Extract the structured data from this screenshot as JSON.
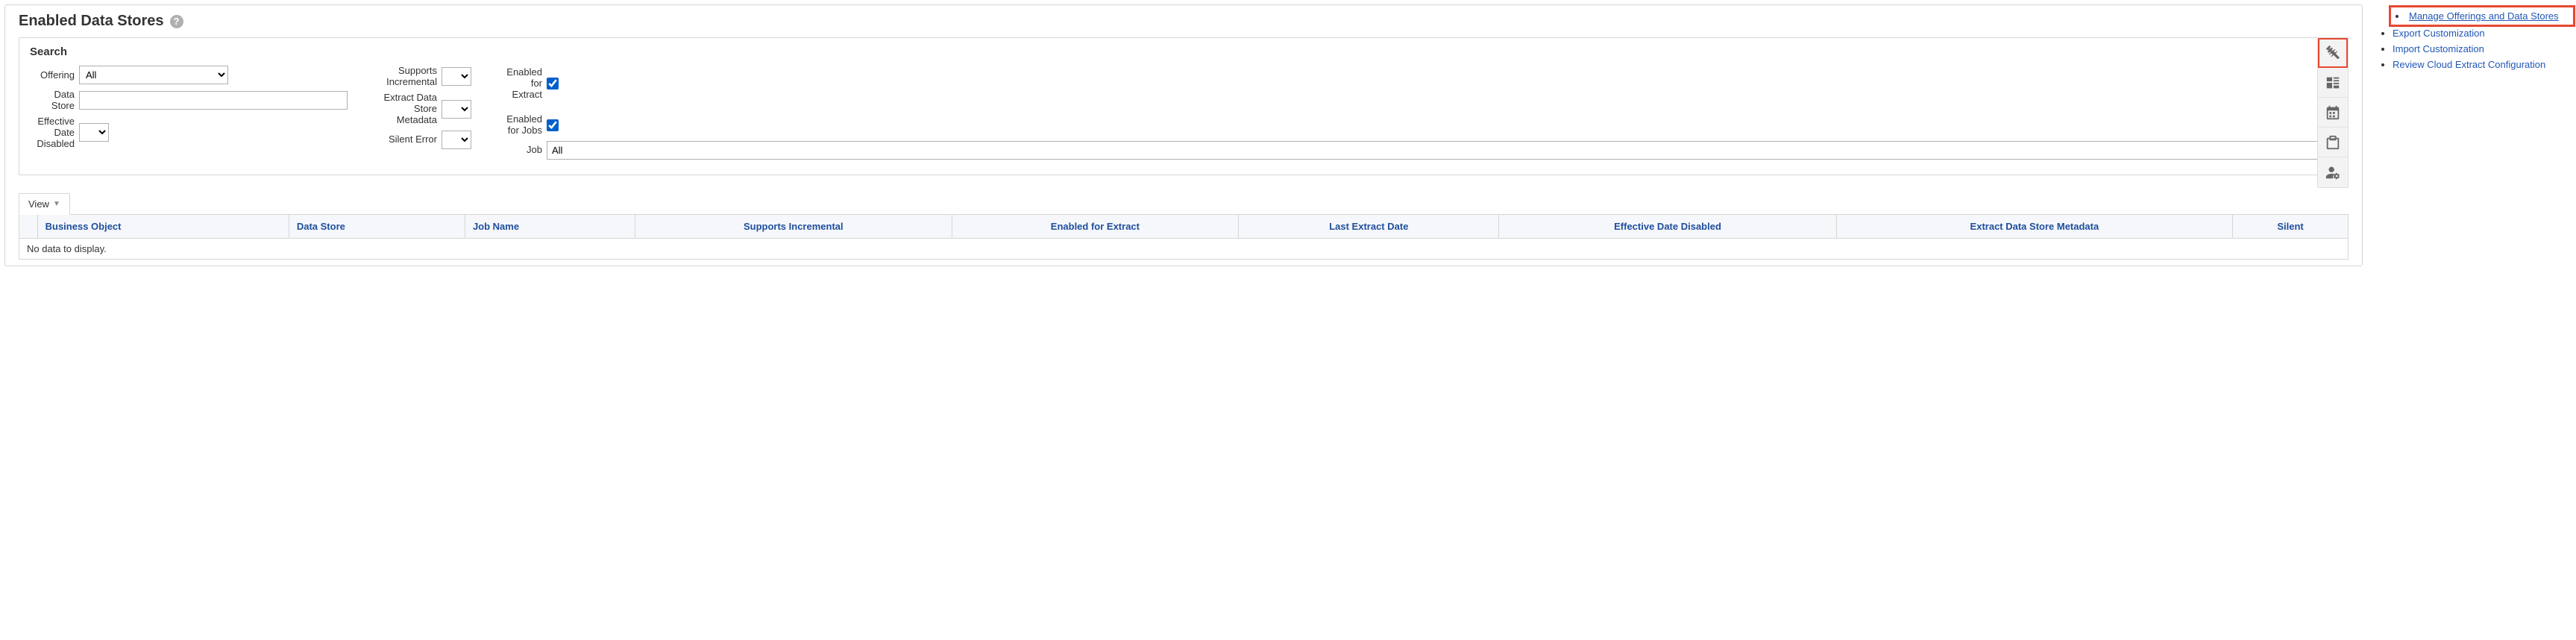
{
  "page": {
    "title": "Enabled Data Stores"
  },
  "search": {
    "title": "Search",
    "offering": {
      "label": "Offering",
      "value": "All"
    },
    "data_store": {
      "label": "Data Store",
      "value": ""
    },
    "effective_date_disabled": {
      "label": "Effective Date Disabled",
      "value": ""
    },
    "supports_incremental": {
      "label": "Supports Incremental",
      "value": ""
    },
    "extract_data_store_metadata": {
      "label": "Extract Data Store Metadata",
      "value": ""
    },
    "silent_error": {
      "label": "Silent Error",
      "value": ""
    },
    "enabled_for_extract": {
      "label": "Enabled for Extract",
      "checked": true
    },
    "enabled_for_jobs": {
      "label": "Enabled for Jobs",
      "checked": true
    },
    "job": {
      "label": "Job",
      "value": "All"
    }
  },
  "view": {
    "label": "View"
  },
  "table": {
    "columns": [
      "Business Object",
      "Data Store",
      "Job Name",
      "Supports Incremental",
      "Enabled for Extract",
      "Last Extract Date",
      "Effective Date Disabled",
      "Extract Data Store Metadata",
      "Silent"
    ],
    "empty_message": "No data to display."
  },
  "right_links": [
    {
      "label": "Manage Offerings and Data Stores",
      "highlighted": true
    },
    {
      "label": "Export Customization",
      "highlighted": false
    },
    {
      "label": "Import Customization",
      "highlighted": false
    },
    {
      "label": "Review Cloud Extract Configuration",
      "highlighted": false
    }
  ],
  "side_icons": [
    {
      "name": "tools-icon",
      "highlighted": true
    },
    {
      "name": "manage-icon",
      "highlighted": false
    },
    {
      "name": "calendar-icon",
      "highlighted": false
    },
    {
      "name": "clipboard-icon",
      "highlighted": false
    },
    {
      "name": "user-settings-icon",
      "highlighted": false
    }
  ]
}
